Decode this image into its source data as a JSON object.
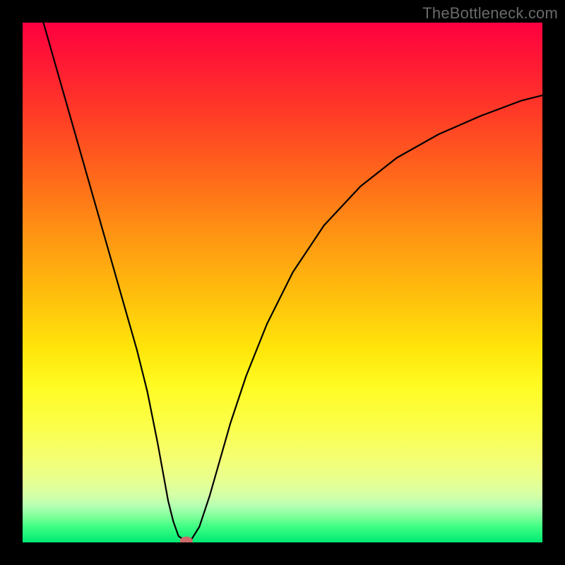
{
  "watermark": "TheBottleneck.com",
  "chart_data": {
    "type": "line",
    "title": "",
    "xlabel": "",
    "ylabel": "",
    "xlim": [
      0,
      100
    ],
    "ylim": [
      0,
      100
    ],
    "grid": false,
    "legend": false,
    "series": [
      {
        "name": "bottleneck-curve",
        "x": [
          4,
          6,
          8,
          10,
          12,
          14,
          16,
          18,
          20,
          22,
          23,
          24,
          25,
          26,
          27,
          28,
          29,
          30,
          31.5,
          32.5,
          34,
          36,
          38,
          40,
          43,
          47,
          52,
          58,
          65,
          72,
          80,
          88,
          96,
          100
        ],
        "y": [
          100,
          93,
          86,
          79,
          72,
          65,
          58,
          51,
          44,
          37,
          33,
          29,
          24,
          19,
          13.5,
          8,
          4,
          1.2,
          0.2,
          0.6,
          3,
          9,
          16,
          23,
          32,
          42,
          52,
          61,
          68.5,
          74,
          78.5,
          82,
          85,
          86
        ]
      }
    ],
    "marker": {
      "name": "optimum-marker",
      "x": 31.5,
      "y": 0.3,
      "color": "#cf6a6a"
    },
    "background_gradient": [
      {
        "stop": 0,
        "color": "#ff0040"
      },
      {
        "stop": 50,
        "color": "#ffce08"
      },
      {
        "stop": 80,
        "color": "#fbff4c"
      },
      {
        "stop": 100,
        "color": "#00e974"
      }
    ]
  }
}
